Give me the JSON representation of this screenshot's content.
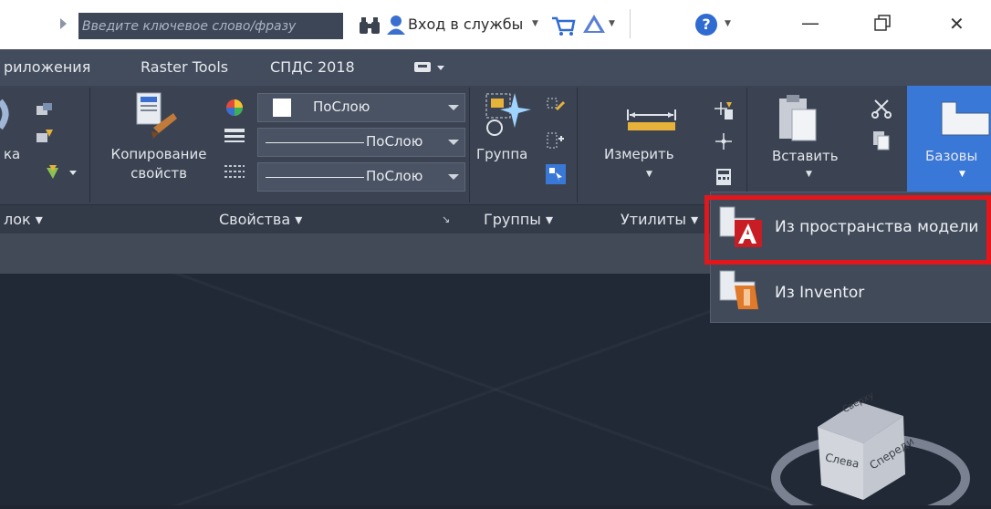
{
  "titlebar": {
    "search_placeholder": "Введите ключевое слово/фразу",
    "signin_label": "Вход в службы",
    "help_icon_glyph": "?",
    "minimize_glyph": "—",
    "close_glyph": "✕"
  },
  "menubar": {
    "tabs": [
      "риложения",
      "Raster Tools",
      "СПДС 2018"
    ]
  },
  "ribbon": {
    "left_partial_label": "ка",
    "copy_props_line1": "Копирование",
    "copy_props_line2": "свойств",
    "color_combo": "ПоСлою",
    "linetype_combo": "ПоСлою",
    "lineweight_combo": "ПоСлою",
    "group_label": "Группа",
    "measure_label": "Измерить",
    "paste_label": "Вставить",
    "base_label": "Базовы",
    "panels": {
      "block": "лок ▾",
      "properties": "Свойства ▾",
      "groups": "Группы ▾",
      "utilities": "Утилиты ▾"
    }
  },
  "dropdown": {
    "items": [
      {
        "label": "Из пространства модели",
        "icon": "autocad-icon"
      },
      {
        "label": "Из Inventor",
        "icon": "inventor-icon"
      }
    ]
  },
  "viewcube": {
    "top": "Сверху",
    "left": "Слева",
    "front": "Спереди"
  },
  "colors": {
    "highlight": "#e3161c",
    "ribbon_bg": "#3b4352",
    "canvas_bg": "#222936"
  }
}
